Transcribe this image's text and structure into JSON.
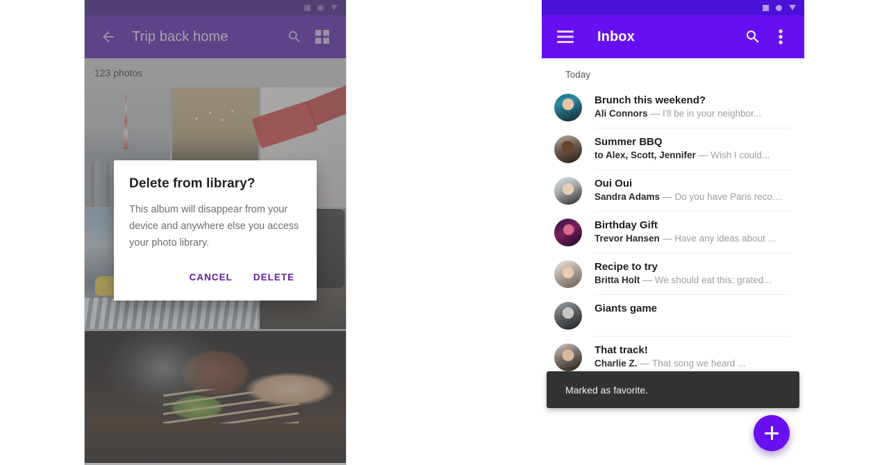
{
  "left_phone": {
    "statusbar": {
      "icons": [
        "square-icon",
        "circle-icon",
        "triangle-down-icon"
      ]
    },
    "appbar": {
      "back_icon": "back-arrow-icon",
      "title": "Trip back home",
      "search_icon": "search-icon",
      "grid_icon": "grid-view-icon"
    },
    "content": {
      "photo_count": "123 photos",
      "photos": [
        {
          "name": "tokyo-tower-photo"
        },
        {
          "name": "crowd-festival-photo"
        },
        {
          "name": "white-shoes-photo"
        },
        {
          "name": "street-taxi-photo"
        },
        {
          "name": "winter-coats-photo"
        },
        {
          "name": "bbq-grill-photo"
        }
      ]
    },
    "dialog": {
      "title": "Delete from library?",
      "body": "This album will disappear from your device and anywhere else you access your photo library.",
      "cancel_label": "CANCEL",
      "confirm_label": "DELETE",
      "accent_color": "#6A1B9A"
    },
    "colors": {
      "appbar": "#4A13A8",
      "statusbar": "#31077A"
    }
  },
  "right_phone": {
    "statusbar": {
      "icons": [
        "square-icon",
        "circle-icon",
        "triangle-down-icon"
      ]
    },
    "appbar": {
      "menu_icon": "hamburger-menu-icon",
      "title": "Inbox",
      "search_icon": "search-icon",
      "overflow_icon": "more-vert-icon"
    },
    "section_label": "Today",
    "messages": [
      {
        "avatar": "avatar-ali-connors",
        "subject": "Brunch this weekend?",
        "sender": "Ali Connors",
        "dash": "—",
        "snippet": "I'll be in your neighbor..."
      },
      {
        "avatar": "avatar-summer-bbq",
        "subject": "Summer BBQ",
        "sender": "to Alex, Scott, Jennifer",
        "dash": "—",
        "snippet": "Wish I could..."
      },
      {
        "avatar": "avatar-sandra-adams",
        "subject": "Oui Oui",
        "sender": "Sandra Adams",
        "dash": "—",
        "snippet": "Do you have Paris reco...."
      },
      {
        "avatar": "avatar-trevor-hansen",
        "subject": "Birthday Gift",
        "sender": "Trevor Hansen",
        "dash": "—",
        "snippet": "Have any ideas about ..."
      },
      {
        "avatar": "avatar-britta-holt",
        "subject": "Recipe to try",
        "sender": "Britta Holt",
        "dash": "—",
        "snippet": "We should eat this: grated..."
      },
      {
        "avatar": "avatar-giants-game",
        "subject": "Giants game",
        "sender": "",
        "dash": "",
        "snippet": ""
      },
      {
        "avatar": "avatar-charlie-z",
        "subject": "That track!",
        "sender": "Charlie Z.",
        "dash": "—",
        "snippet": "That song we heard ..."
      }
    ],
    "snackbar": {
      "message": "Marked as favorite."
    },
    "fab": {
      "icon": "plus-icon",
      "color": "#6A10F0"
    },
    "colors": {
      "appbar": "#6610F2",
      "statusbar": "#4A11D8"
    }
  }
}
